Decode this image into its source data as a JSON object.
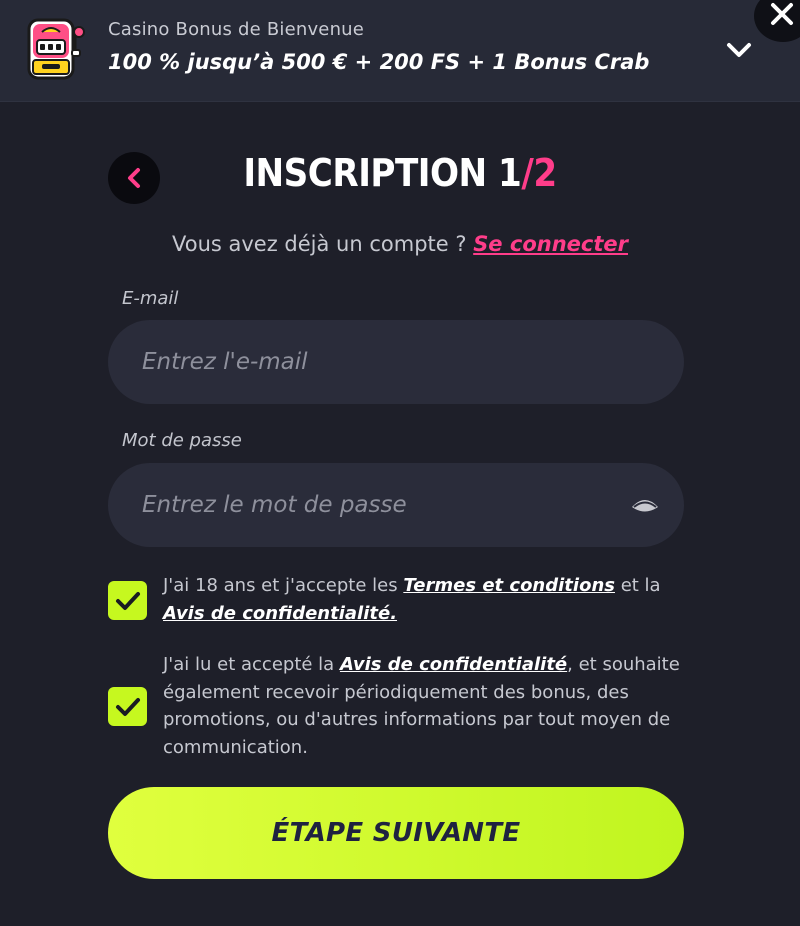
{
  "banner": {
    "subtitle": "Casino Bonus de Bienvenue",
    "title": "100 % jusqu’à 500 € + 200 FS + 1 Bonus Crab"
  },
  "header": {
    "title_main": "INSCRIPTION 1",
    "title_slash": "/",
    "title_step": "2",
    "login_prompt": "Vous avez déjà un compte ? ",
    "login_link": "Se connecter"
  },
  "form": {
    "email": {
      "label": "E-mail",
      "value": "",
      "placeholder": "Entrez l'e-mail"
    },
    "password": {
      "label": "Mot de passe",
      "value": "",
      "placeholder": "Entrez le mot de passe"
    }
  },
  "consents": [
    {
      "checked": true,
      "text_before": "J'ai 18 ans et j'accepte les ",
      "link1": "Termes et conditions",
      "text_middle": " et la ",
      "link2": "Avis de confidentialité."
    },
    {
      "checked": true,
      "text_before": "J'ai lu et accepté la ",
      "link": "Avis de confidentialité",
      "text_after": ", et souhaite également recevoir périodiquement des bonus, des promotions, ou d'autres informations par tout moyen de communication."
    }
  ],
  "cta": {
    "label": "ÉTAPE SUIVANTE"
  },
  "icons": {
    "banner": "slot-machine-icon",
    "expand": "chevron-down-icon",
    "close": "close-icon",
    "back": "chevron-left-icon",
    "password_toggle": "eye-icon",
    "check": "checkmark-icon"
  },
  "colors": {
    "background": "#1e1f29",
    "banner": "#272a37",
    "input": "#2a2c3a",
    "accent_pink": "#ff3d8a",
    "accent_lime": "#c6f81f",
    "cta_text": "#1f2240"
  }
}
